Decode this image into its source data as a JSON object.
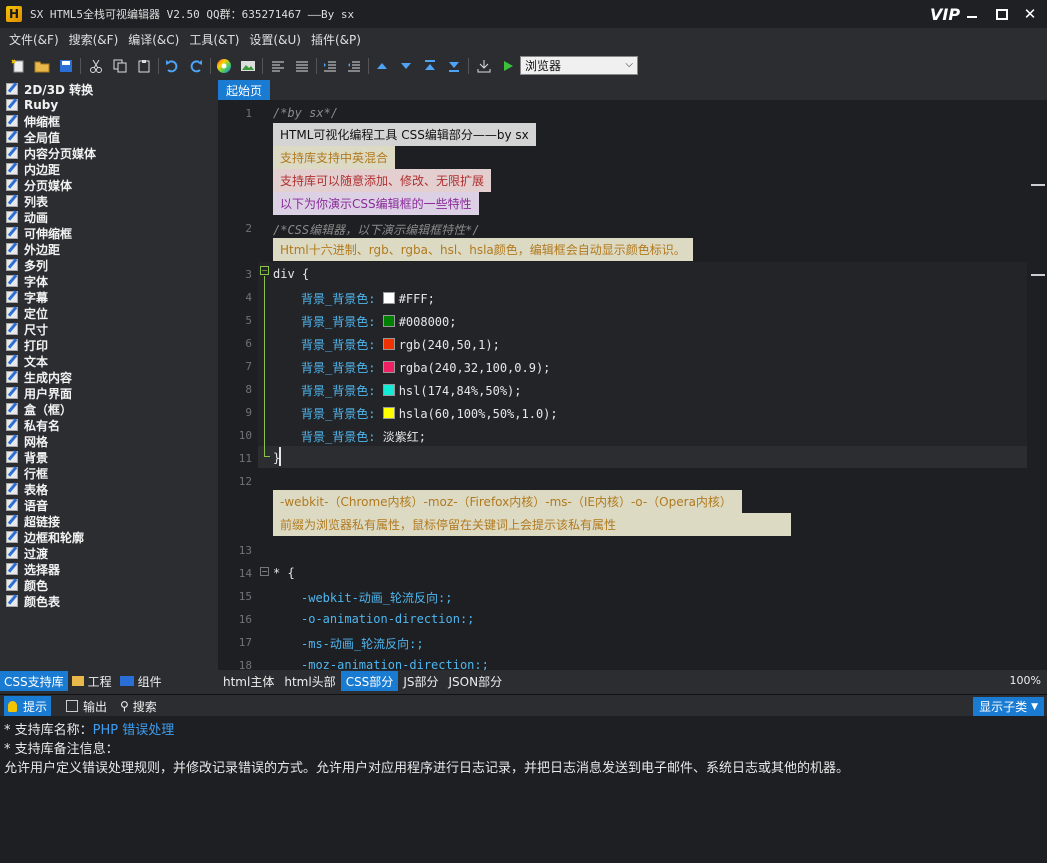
{
  "window": {
    "title": "SX HTML5全栈可视编辑器 V2.50 QQ群：635271467 ——By sx",
    "vip": "VIP",
    "logo": "H"
  },
  "menu": [
    "文件(&F)",
    "搜索(&F)",
    "编译(&C)",
    "工具(&T)",
    "设置(&U)",
    "插件(&P)"
  ],
  "toolbar": {
    "browser_select": "浏览器"
  },
  "sidebar": {
    "items": [
      "2D/3D 转换",
      "Ruby",
      "伸缩框",
      "全局值",
      "内容分页媒体",
      "内边距",
      "分页媒体",
      "列表",
      "动画",
      "可伸缩框",
      "外边距",
      "多列",
      "字体",
      "字幕",
      "定位",
      "尺寸",
      "打印",
      "文本",
      "生成内容",
      "用户界面",
      "盒（框）",
      "私有名",
      "网格",
      "背景",
      "行框",
      "表格",
      "语音",
      "超链接",
      "边框和轮廓",
      "过渡",
      "选择器",
      "颜色",
      "颜色表"
    ],
    "tabs": [
      "CSS支持库",
      "工程",
      "组件"
    ]
  },
  "editor": {
    "tab": "起始页",
    "comment1": "/*by sx*/",
    "hl1": "HTML可视化编程工具 CSS编辑部分——by sx",
    "hl2": "支持库支持中英混合",
    "hl3": "支持库可以随意添加、修改、无限扩展",
    "hl4": "以下为你演示CSS编辑框的一些特性",
    "comment2": "/*CSS编辑器，以下演示编辑框特性*/",
    "hl5": "Html十六进制、rgb、rgba、hsl、hsla颜色，编辑框会自动显示颜色标识。",
    "selector1": "div {",
    "close1": "}",
    "prop": "背景_背景色:",
    "decls": [
      {
        "value": "#FFF;",
        "color": "#ffffff"
      },
      {
        "value": "#008000;",
        "color": "#008000"
      },
      {
        "value": "rgb(240,50,1);",
        "color": "#f03201"
      },
      {
        "value": "rgba(240,32,100,0.9);",
        "color": "#f02064"
      },
      {
        "value": "hsl(174,84%,50%);",
        "color": "#14ebd6"
      },
      {
        "value": "hsla(60,100%,50%,1.0);",
        "color": "#ffff00"
      },
      {
        "value": "淡紫红;",
        "color": ""
      }
    ],
    "hl6": "-webkit-（Chrome内核）-moz-（Firefox内核）-ms-（IE内核）-o-（Opera内核）",
    "hl7": "前缀为浏览器私有属性，鼠标停留在关键词上会提示该私有属性",
    "selector2": "* {",
    "lines2": [
      "-webkit-动画_轮流反向:;",
      "-o-animation-direction:;",
      "-ms-动画_轮流反向:;",
      "-moz-animation-direction:;"
    ],
    "line_numbers": [
      "1",
      "2",
      "3",
      "4",
      "5",
      "6",
      "7",
      "8",
      "9",
      "10",
      "11",
      "12",
      "13",
      "14",
      "15",
      "16",
      "17",
      "18"
    ]
  },
  "bottom_tabs": [
    "html主体",
    "html头部",
    "CSS部分",
    "JS部分",
    "JSON部分"
  ],
  "zoom": "100%",
  "output": {
    "tabs": [
      "提示",
      "输出",
      "搜索"
    ],
    "show_sub": "显示子类",
    "line1_prefix": "*  支持库名称：",
    "line1_value": "PHP 错误处理",
    "line2": "*  支持库备注信息：",
    "line3": "允许用户定义错误处理规则，并修改记录错误的方式。允许用户对应用程序进行日志记录，并把日志消息发送到电子邮件、系统日志或其他的机器。"
  }
}
